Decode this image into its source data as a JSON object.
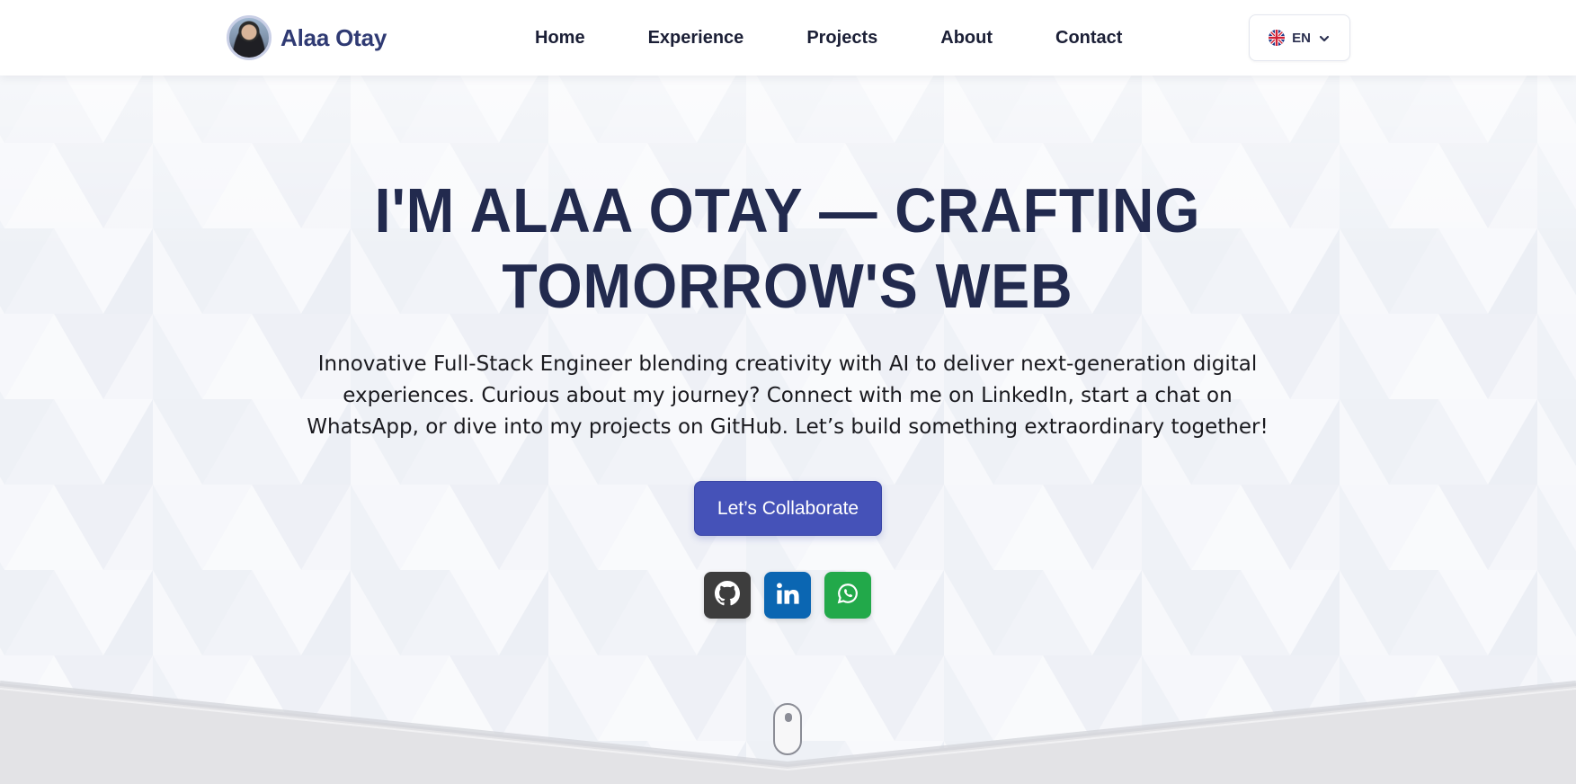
{
  "header": {
    "brand_name": "Alaa Otay",
    "nav": [
      "Home",
      "Experience",
      "Projects",
      "About",
      "Contact"
    ],
    "language": {
      "code": "EN",
      "flag_icon": "uk-flag-icon"
    }
  },
  "hero": {
    "title_line1": "I'M ALAA OTAY — CRAFTING",
    "title_line2": "TOMORROW'S WEB",
    "subtitle": "Innovative Full-Stack Engineer blending creativity with AI to deliver next-generation digital experiences. Curious about my journey? Connect with me on LinkedIn, start a chat on WhatsApp, or dive into my projects on GitHub. Let’s build something extraordinary together!",
    "cta_label": "Let’s Collaborate",
    "social": [
      {
        "name": "github-icon",
        "color": "#3d3d3d"
      },
      {
        "name": "linkedin-icon",
        "color": "#0b66b2"
      },
      {
        "name": "whatsapp-icon",
        "color": "#22a94a"
      }
    ]
  },
  "colors": {
    "brand": "#2f3a73",
    "title": "#222a4e",
    "accent": "#4552b8",
    "background": "#f4f6fa"
  }
}
